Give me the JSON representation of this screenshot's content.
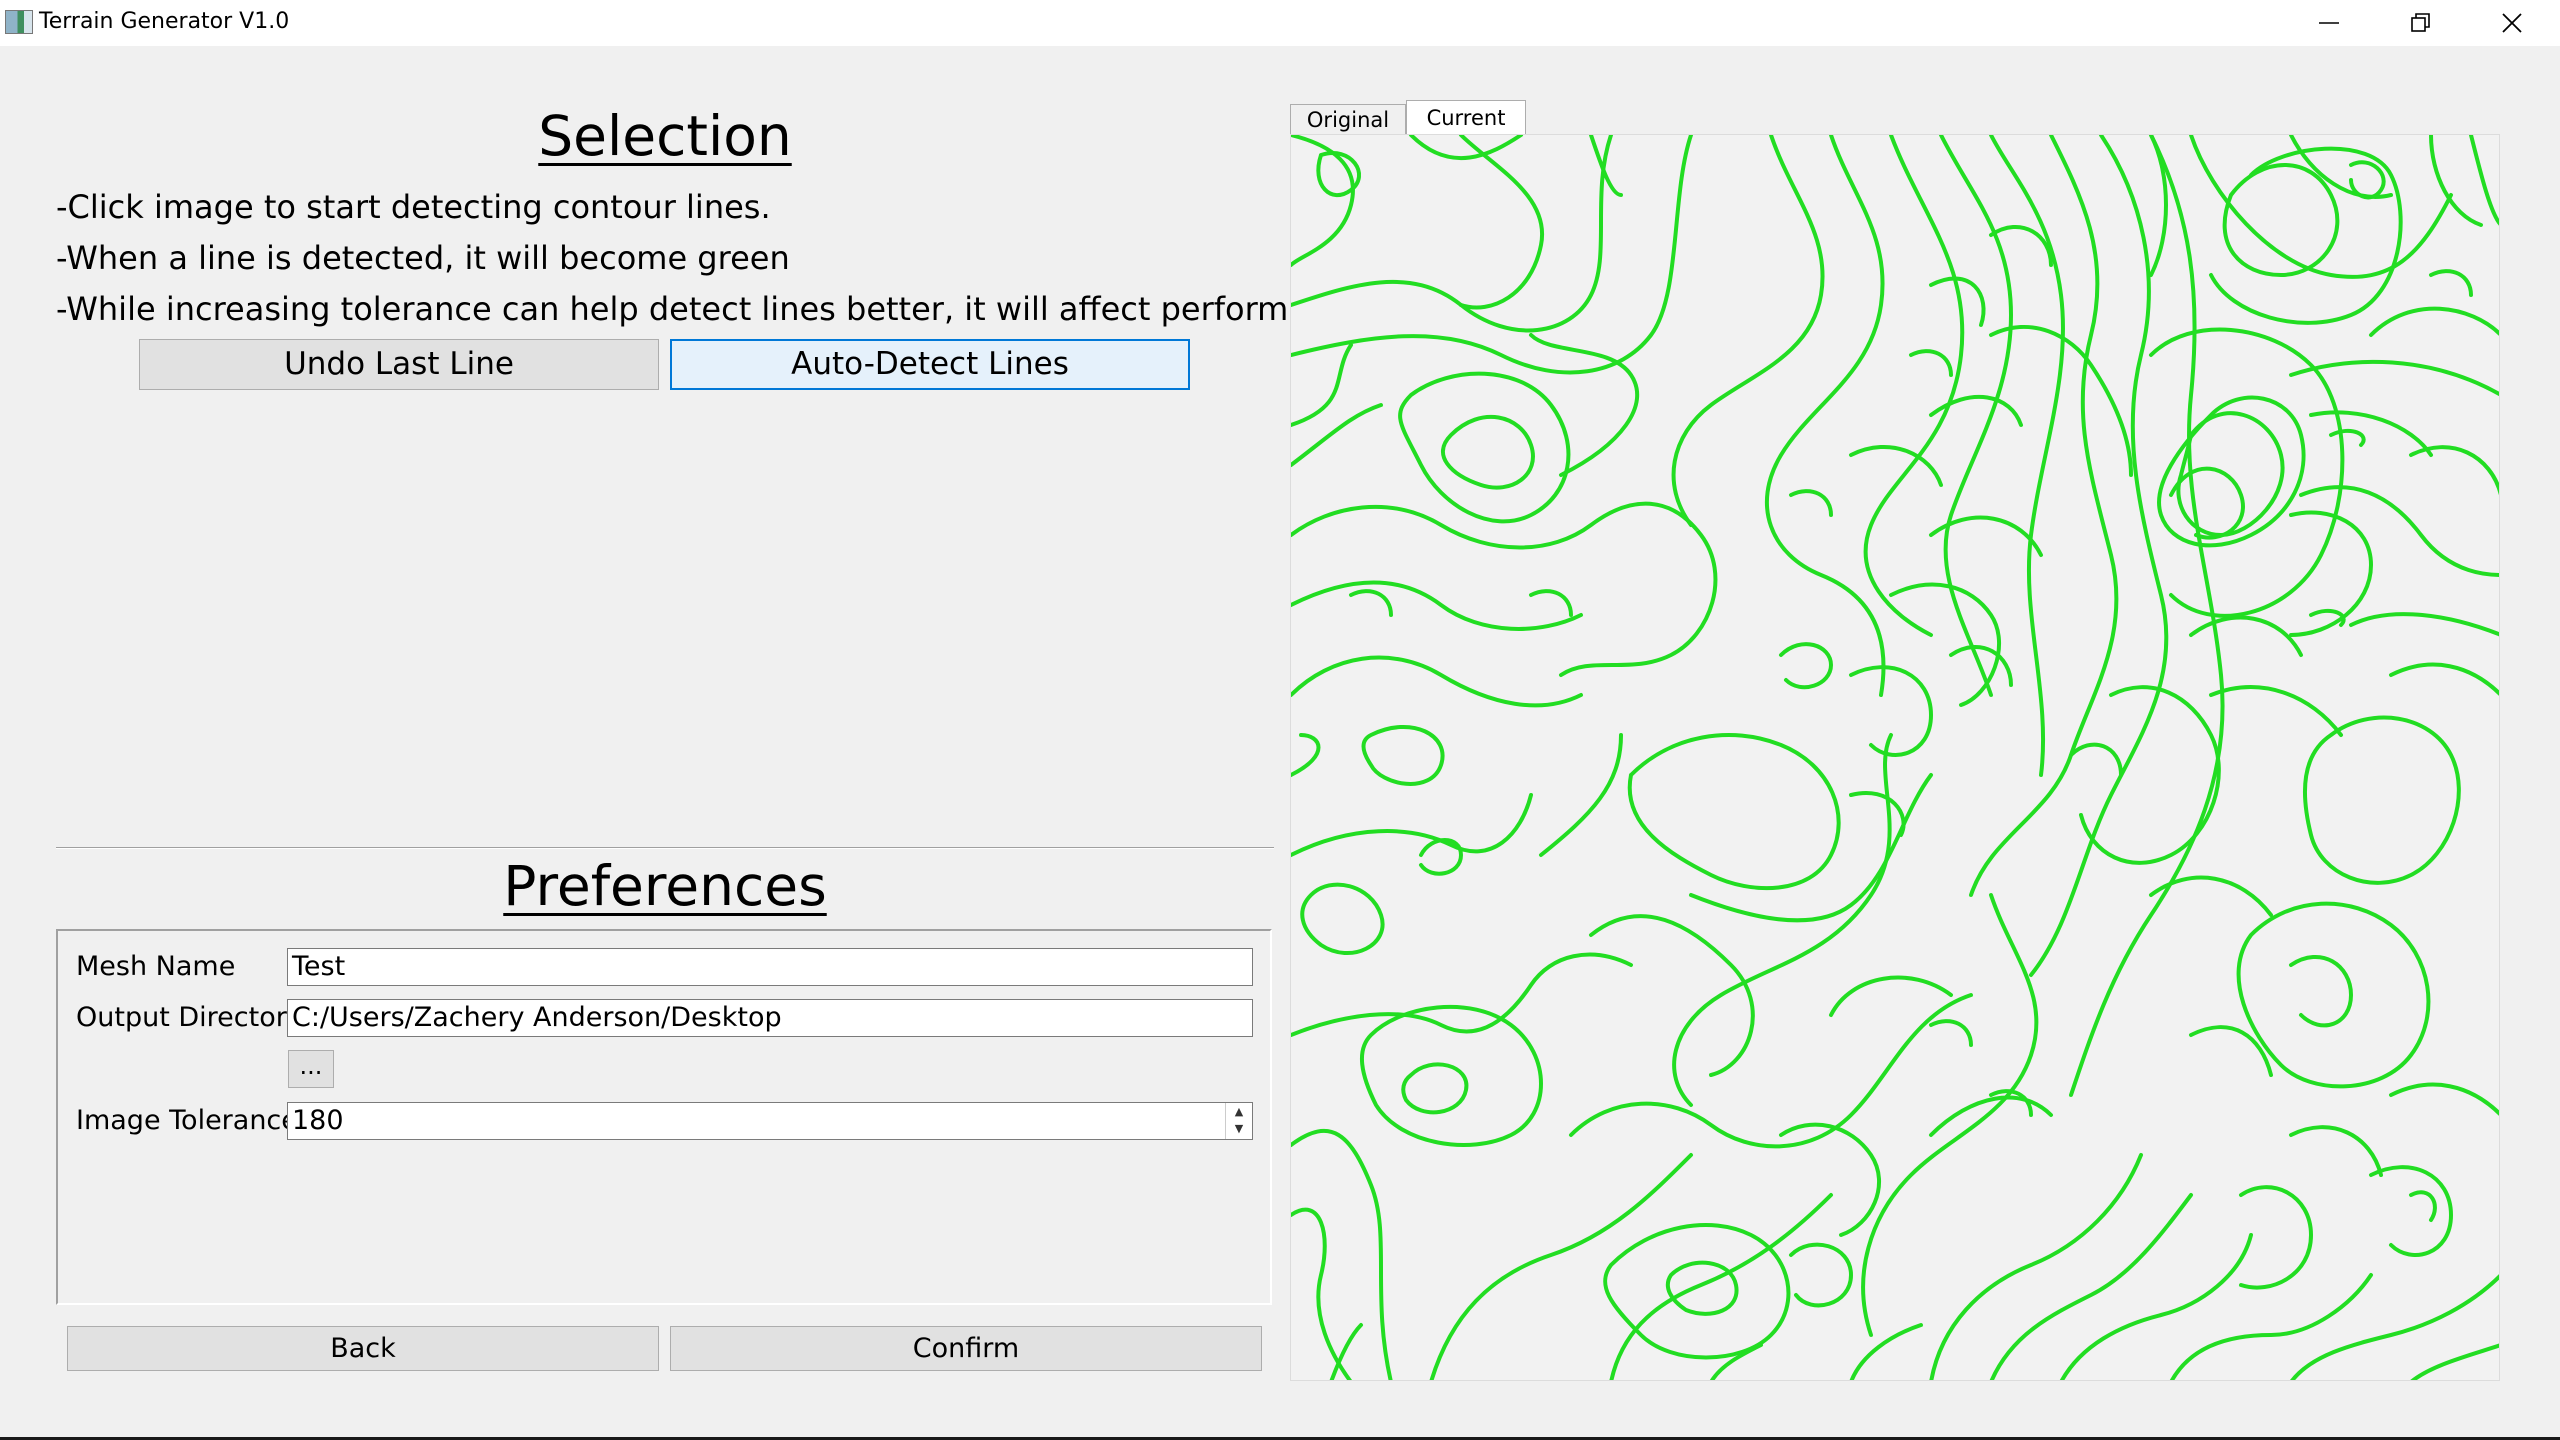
{
  "window": {
    "title": "Terrain Generator V1.0"
  },
  "selection": {
    "heading": "Selection",
    "instructions": [
      "-Click image to start detecting contour lines.",
      "-When a line is detected, it will become green",
      "-While increasing tolerance can help detect lines better, it will affect performance."
    ],
    "undo_label": "Undo Last Line",
    "autodetect_label": "Auto-Detect Lines"
  },
  "preferences": {
    "heading": "Preferences",
    "mesh_name_label": "Mesh Name",
    "mesh_name_value": "Test",
    "output_dir_label": "Output Directory",
    "output_dir_value": "C:/Users/Zachery Anderson/Desktop",
    "browse_label": "...",
    "tolerance_label": "Image Tolerance",
    "tolerance_value": "180"
  },
  "footer": {
    "back_label": "Back",
    "confirm_label": "Confirm"
  },
  "tabs": [
    {
      "label": "Original",
      "active": false
    },
    {
      "label": "Current",
      "active": true
    }
  ],
  "contour_color": "#22dd22",
  "icons": {
    "minimize": "minimize-icon",
    "restore": "restore-icon",
    "close": "close-icon"
  }
}
